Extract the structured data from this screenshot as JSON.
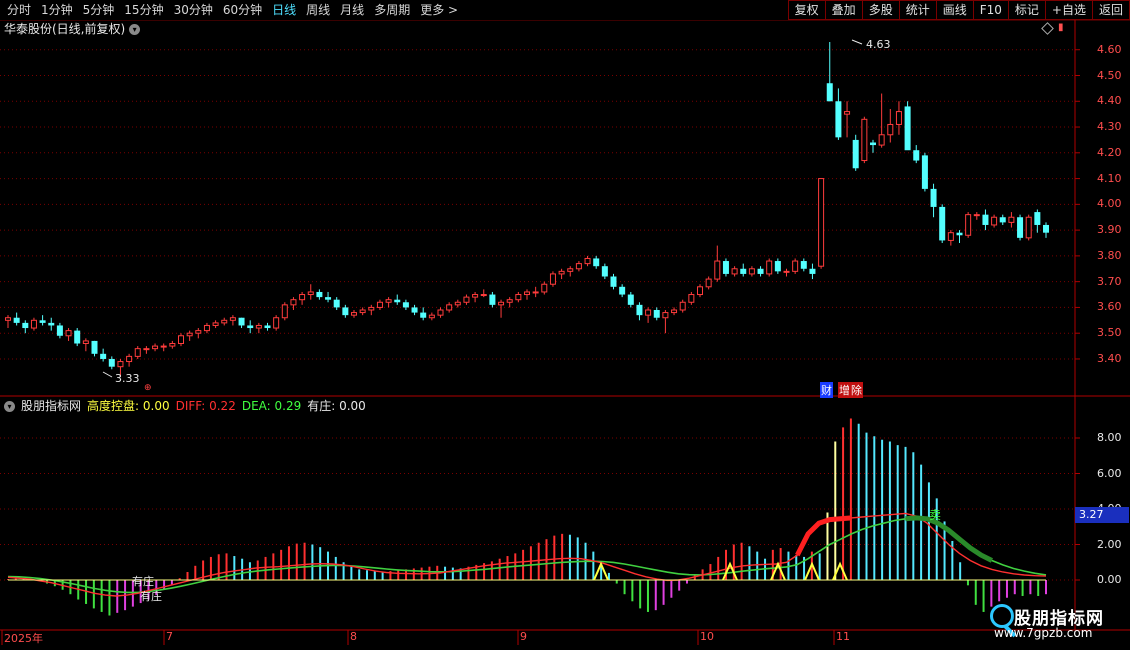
{
  "toolbar": {
    "tabs": [
      {
        "label": "分时",
        "active": false
      },
      {
        "label": "1分钟",
        "active": false
      },
      {
        "label": "5分钟",
        "active": false
      },
      {
        "label": "15分钟",
        "active": false
      },
      {
        "label": "30分钟",
        "active": false
      },
      {
        "label": "60分钟",
        "active": false
      },
      {
        "label": "日线",
        "active": true
      },
      {
        "label": "周线",
        "active": false
      },
      {
        "label": "月线",
        "active": false
      },
      {
        "label": "多周期",
        "active": false
      },
      {
        "label": "更多 >",
        "active": false
      }
    ],
    "tools": [
      "复权",
      "叠加",
      "多股",
      "统计",
      "画线",
      "F10",
      "标记",
      "+自选",
      "返回"
    ]
  },
  "main_panel": {
    "title": "华泰股份(日线,前复权)",
    "price_labels": [
      "4.60",
      "4.50",
      "4.40",
      "4.30",
      "4.20",
      "4.10",
      "4.00",
      "3.90",
      "3.80",
      "3.70",
      "3.60",
      "3.50",
      "3.40"
    ],
    "high_marker": "4.63",
    "low_marker": "3.33",
    "event_icons": [
      "财",
      "增",
      "除"
    ]
  },
  "indicator_panel": {
    "name": "股朋指标网",
    "items": [
      {
        "label": "高度控盘:",
        "value": "0.00",
        "color": "#ffff40"
      },
      {
        "label": "DIFF:",
        "value": "0.22",
        "color": "#ff3030"
      },
      {
        "label": "DEA:",
        "value": "0.29",
        "color": "#40ff40"
      },
      {
        "label": "有庄:",
        "value": "0.00",
        "color": "#e8e8e8"
      }
    ],
    "y_labels": [
      "8.00",
      "6.00",
      "4.00",
      "2.00",
      "0.00"
    ],
    "current_value": "3.27",
    "annotations": [
      "有庄",
      "有庄",
      "卖"
    ]
  },
  "x_axis": {
    "labels": [
      "2025年",
      "7",
      "8",
      "9",
      "10",
      "11"
    ]
  },
  "watermark": {
    "title": "股朋指标网",
    "url": "www.7gpzb.com"
  },
  "colors": {
    "up": "#ff3c3c",
    "down": "#54ffff",
    "grid": "#8a0000",
    "diff": "#ff3030",
    "dea": "#40d040"
  },
  "chart_data": {
    "type": "candlestick",
    "price_ylim": [
      3.3,
      4.67
    ],
    "indicator_ylim": [
      -2.3,
      9.2
    ],
    "candles": [
      [
        3.55,
        3.57,
        3.52,
        3.56
      ],
      [
        3.56,
        3.58,
        3.53,
        3.54
      ],
      [
        3.54,
        3.55,
        3.5,
        3.52
      ],
      [
        3.52,
        3.56,
        3.51,
        3.55
      ],
      [
        3.55,
        3.57,
        3.53,
        3.54
      ],
      [
        3.54,
        3.56,
        3.51,
        3.53
      ],
      [
        3.53,
        3.54,
        3.48,
        3.49
      ],
      [
        3.49,
        3.52,
        3.47,
        3.51
      ],
      [
        3.51,
        3.52,
        3.45,
        3.46
      ],
      [
        3.46,
        3.48,
        3.43,
        3.47
      ],
      [
        3.47,
        3.47,
        3.41,
        3.42
      ],
      [
        3.42,
        3.44,
        3.39,
        3.4
      ],
      [
        3.4,
        3.41,
        3.36,
        3.37
      ],
      [
        3.37,
        3.4,
        3.33,
        3.39
      ],
      [
        3.39,
        3.42,
        3.37,
        3.41
      ],
      [
        3.41,
        3.45,
        3.4,
        3.44
      ],
      [
        3.44,
        3.45,
        3.42,
        3.44
      ],
      [
        3.44,
        3.46,
        3.43,
        3.45
      ],
      [
        3.45,
        3.46,
        3.43,
        3.45
      ],
      [
        3.45,
        3.47,
        3.44,
        3.46
      ],
      [
        3.46,
        3.5,
        3.45,
        3.49
      ],
      [
        3.49,
        3.51,
        3.47,
        3.5
      ],
      [
        3.5,
        3.52,
        3.48,
        3.51
      ],
      [
        3.51,
        3.54,
        3.5,
        3.53
      ],
      [
        3.53,
        3.55,
        3.52,
        3.54
      ],
      [
        3.54,
        3.56,
        3.53,
        3.55
      ],
      [
        3.55,
        3.57,
        3.53,
        3.56
      ],
      [
        3.56,
        3.56,
        3.52,
        3.53
      ],
      [
        3.53,
        3.55,
        3.5,
        3.52
      ],
      [
        3.52,
        3.54,
        3.5,
        3.53
      ],
      [
        3.53,
        3.54,
        3.51,
        3.52
      ],
      [
        3.52,
        3.57,
        3.51,
        3.56
      ],
      [
        3.56,
        3.62,
        3.55,
        3.61
      ],
      [
        3.61,
        3.64,
        3.59,
        3.63
      ],
      [
        3.63,
        3.66,
        3.61,
        3.65
      ],
      [
        3.65,
        3.69,
        3.63,
        3.66
      ],
      [
        3.66,
        3.67,
        3.63,
        3.64
      ],
      [
        3.64,
        3.66,
        3.62,
        3.63
      ],
      [
        3.63,
        3.64,
        3.59,
        3.6
      ],
      [
        3.6,
        3.61,
        3.56,
        3.57
      ],
      [
        3.57,
        3.59,
        3.56,
        3.58
      ],
      [
        3.58,
        3.6,
        3.57,
        3.59
      ],
      [
        3.59,
        3.61,
        3.57,
        3.6
      ],
      [
        3.6,
        3.63,
        3.59,
        3.62
      ],
      [
        3.62,
        3.64,
        3.6,
        3.63
      ],
      [
        3.63,
        3.65,
        3.61,
        3.62
      ],
      [
        3.62,
        3.63,
        3.59,
        3.6
      ],
      [
        3.6,
        3.61,
        3.57,
        3.58
      ],
      [
        3.58,
        3.6,
        3.55,
        3.56
      ],
      [
        3.56,
        3.58,
        3.55,
        3.57
      ],
      [
        3.57,
        3.6,
        3.56,
        3.59
      ],
      [
        3.59,
        3.62,
        3.58,
        3.61
      ],
      [
        3.61,
        3.63,
        3.6,
        3.62
      ],
      [
        3.62,
        3.65,
        3.61,
        3.64
      ],
      [
        3.64,
        3.66,
        3.62,
        3.65
      ],
      [
        3.65,
        3.67,
        3.64,
        3.65
      ],
      [
        3.65,
        3.66,
        3.6,
        3.61
      ],
      [
        3.61,
        3.63,
        3.56,
        3.62
      ],
      [
        3.62,
        3.64,
        3.6,
        3.63
      ],
      [
        3.63,
        3.66,
        3.62,
        3.65
      ],
      [
        3.65,
        3.67,
        3.63,
        3.66
      ],
      [
        3.66,
        3.68,
        3.64,
        3.66
      ],
      [
        3.66,
        3.7,
        3.65,
        3.69
      ],
      [
        3.69,
        3.74,
        3.68,
        3.73
      ],
      [
        3.73,
        3.75,
        3.71,
        3.74
      ],
      [
        3.74,
        3.76,
        3.72,
        3.75
      ],
      [
        3.75,
        3.78,
        3.74,
        3.77
      ],
      [
        3.77,
        3.8,
        3.76,
        3.79
      ],
      [
        3.79,
        3.8,
        3.75,
        3.76
      ],
      [
        3.76,
        3.77,
        3.71,
        3.72
      ],
      [
        3.72,
        3.73,
        3.67,
        3.68
      ],
      [
        3.68,
        3.69,
        3.64,
        3.65
      ],
      [
        3.65,
        3.66,
        3.6,
        3.61
      ],
      [
        3.61,
        3.62,
        3.55,
        3.57
      ],
      [
        3.57,
        3.6,
        3.54,
        3.59
      ],
      [
        3.59,
        3.6,
        3.55,
        3.56
      ],
      [
        3.56,
        3.59,
        3.5,
        3.58
      ],
      [
        3.58,
        3.6,
        3.57,
        3.59
      ],
      [
        3.59,
        3.63,
        3.58,
        3.62
      ],
      [
        3.62,
        3.66,
        3.61,
        3.65
      ],
      [
        3.65,
        3.69,
        3.64,
        3.68
      ],
      [
        3.68,
        3.72,
        3.67,
        3.71
      ],
      [
        3.71,
        3.84,
        3.7,
        3.78
      ],
      [
        3.78,
        3.79,
        3.72,
        3.73
      ],
      [
        3.73,
        3.76,
        3.72,
        3.75
      ],
      [
        3.75,
        3.77,
        3.72,
        3.73
      ],
      [
        3.73,
        3.76,
        3.72,
        3.75
      ],
      [
        3.75,
        3.76,
        3.72,
        3.73
      ],
      [
        3.73,
        3.79,
        3.72,
        3.78
      ],
      [
        3.78,
        3.79,
        3.73,
        3.74
      ],
      [
        3.74,
        3.75,
        3.72,
        3.74
      ],
      [
        3.74,
        3.79,
        3.73,
        3.78
      ],
      [
        3.78,
        3.79,
        3.74,
        3.75
      ],
      [
        3.75,
        3.77,
        3.71,
        3.73
      ],
      [
        3.76,
        4.1,
        3.75,
        4.1
      ],
      [
        4.47,
        4.63,
        4.4,
        4.4
      ],
      [
        4.4,
        4.45,
        4.25,
        4.26
      ],
      [
        4.35,
        4.4,
        4.26,
        4.36
      ],
      [
        4.25,
        4.27,
        4.13,
        4.14
      ],
      [
        4.17,
        4.34,
        4.16,
        4.33
      ],
      [
        4.24,
        4.25,
        4.2,
        4.23
      ],
      [
        4.23,
        4.43,
        4.22,
        4.27
      ],
      [
        4.27,
        4.37,
        4.24,
        4.31
      ],
      [
        4.31,
        4.4,
        4.27,
        4.36
      ],
      [
        4.38,
        4.4,
        4.28,
        4.21
      ],
      [
        4.21,
        4.23,
        4.16,
        4.17
      ],
      [
        4.19,
        4.2,
        4.05,
        4.06
      ],
      [
        4.06,
        4.08,
        3.95,
        3.99
      ],
      [
        3.99,
        4.0,
        3.85,
        3.86
      ],
      [
        3.86,
        3.9,
        3.84,
        3.89
      ],
      [
        3.89,
        3.9,
        3.85,
        3.88
      ],
      [
        3.88,
        3.97,
        3.87,
        3.96
      ],
      [
        3.96,
        3.97,
        3.94,
        3.96
      ],
      [
        3.96,
        3.98,
        3.9,
        3.92
      ],
      [
        3.92,
        3.96,
        3.91,
        3.95
      ],
      [
        3.95,
        3.96,
        3.92,
        3.93
      ],
      [
        3.93,
        3.97,
        3.91,
        3.95
      ],
      [
        3.95,
        3.96,
        3.86,
        3.87
      ],
      [
        3.87,
        3.96,
        3.86,
        3.95
      ],
      [
        3.97,
        3.98,
        3.89,
        3.92
      ],
      [
        3.92,
        3.93,
        3.87,
        3.89
      ]
    ],
    "macd_bars": [
      0.05,
      0.08,
      0.05,
      0.02,
      -0.05,
      -0.2,
      -0.35,
      -0.55,
      -0.8,
      -1.1,
      -1.35,
      -1.6,
      -1.8,
      -2.0,
      -1.85,
      -1.7,
      -1.5,
      -1.3,
      -1.1,
      -0.85,
      -0.55,
      -0.25,
      0.1,
      0.45,
      0.8,
      1.1,
      1.3,
      1.45,
      1.5,
      1.35,
      1.2,
      1.0,
      1.1,
      1.3,
      1.5,
      1.7,
      1.9,
      2.05,
      2.1,
      2.0,
      1.85,
      1.6,
      1.3,
      1.0,
      0.8,
      0.6,
      0.55,
      0.5,
      0.45,
      0.5,
      0.55,
      0.6,
      0.65,
      0.7,
      0.75,
      0.8,
      0.75,
      0.7,
      0.65,
      0.75,
      0.85,
      0.95,
      1.05,
      1.2,
      1.35,
      1.5,
      1.7,
      1.9,
      2.1,
      2.3,
      2.5,
      2.6,
      2.55,
      2.4,
      2.1,
      1.6,
      1.0,
      0.4,
      -0.2,
      -0.8,
      -1.2,
      -1.6,
      -1.8,
      -1.7,
      -1.4,
      -1.0,
      -0.6,
      -0.2,
      0.3,
      0.6,
      0.9,
      1.3,
      1.7,
      2.0,
      2.1,
      1.9,
      1.6,
      1.2,
      1.7,
      1.8,
      1.6,
      1.4,
      1.3,
      1.6,
      1.5,
      3.8,
      7.8,
      8.6,
      9.1,
      8.8,
      8.3,
      8.1,
      7.9,
      7.8,
      7.6,
      7.5,
      7.2,
      6.5,
      5.5,
      4.6,
      3.3,
      2.2,
      1.0,
      -0.3,
      -1.4,
      -1.8,
      -1.5,
      -1.2,
      -1.0,
      -0.8,
      -0.9,
      -0.8,
      -0.9,
      -0.8
    ],
    "diff_line": [
      0.15,
      0.1,
      0.05,
      -0.05,
      -0.15,
      -0.3,
      -0.45,
      -0.6,
      -0.75,
      -0.85,
      -0.9,
      -0.85,
      -0.75,
      -0.6,
      -0.45,
      -0.3,
      -0.15,
      0.0,
      0.15,
      0.3,
      0.42,
      0.52,
      0.6,
      0.68,
      0.72,
      0.75,
      0.8,
      0.85,
      0.9,
      0.92,
      0.9,
      0.85,
      0.75,
      0.62,
      0.5,
      0.42,
      0.38,
      0.36,
      0.35,
      0.36,
      0.4,
      0.5,
      0.6,
      0.7,
      0.8,
      0.88,
      0.95,
      1.0,
      1.05,
      1.1,
      1.15,
      1.2,
      1.22,
      1.2,
      1.1,
      0.95,
      0.75,
      0.55,
      0.35,
      0.18,
      0.05,
      -0.02,
      0.0,
      0.1,
      0.25,
      0.4,
      0.55,
      0.7,
      0.8,
      0.85,
      0.88,
      0.9,
      1.0,
      1.4,
      2.6,
      3.2,
      3.4,
      3.45,
      3.5,
      3.55,
      3.6,
      3.65,
      3.7,
      3.75,
      3.6,
      3.2,
      2.6,
      2.0,
      1.5,
      1.1,
      0.8,
      0.6,
      0.45,
      0.35,
      0.28,
      0.24,
      0.22
    ],
    "dea_line": [
      0.2,
      0.18,
      0.14,
      0.08,
      0.0,
      -0.1,
      -0.22,
      -0.35,
      -0.48,
      -0.58,
      -0.66,
      -0.7,
      -0.7,
      -0.65,
      -0.57,
      -0.47,
      -0.35,
      -0.22,
      -0.08,
      0.06,
      0.2,
      0.32,
      0.42,
      0.5,
      0.57,
      0.62,
      0.67,
      0.72,
      0.76,
      0.8,
      0.82,
      0.82,
      0.79,
      0.74,
      0.68,
      0.62,
      0.57,
      0.53,
      0.5,
      0.47,
      0.46,
      0.47,
      0.5,
      0.55,
      0.6,
      0.66,
      0.72,
      0.78,
      0.83,
      0.88,
      0.93,
      0.98,
      1.02,
      1.05,
      1.06,
      1.04,
      0.99,
      0.9,
      0.79,
      0.67,
      0.55,
      0.44,
      0.35,
      0.3,
      0.29,
      0.31,
      0.36,
      0.43,
      0.5,
      0.57,
      0.63,
      0.68,
      0.74,
      0.87,
      1.2,
      1.6,
      2.0,
      2.3,
      2.6,
      2.85,
      3.05,
      3.2,
      3.35,
      3.45,
      3.5,
      3.45,
      3.2,
      2.8,
      2.3,
      1.8,
      1.4,
      1.1,
      0.85,
      0.65,
      0.5,
      0.38,
      0.29
    ]
  }
}
